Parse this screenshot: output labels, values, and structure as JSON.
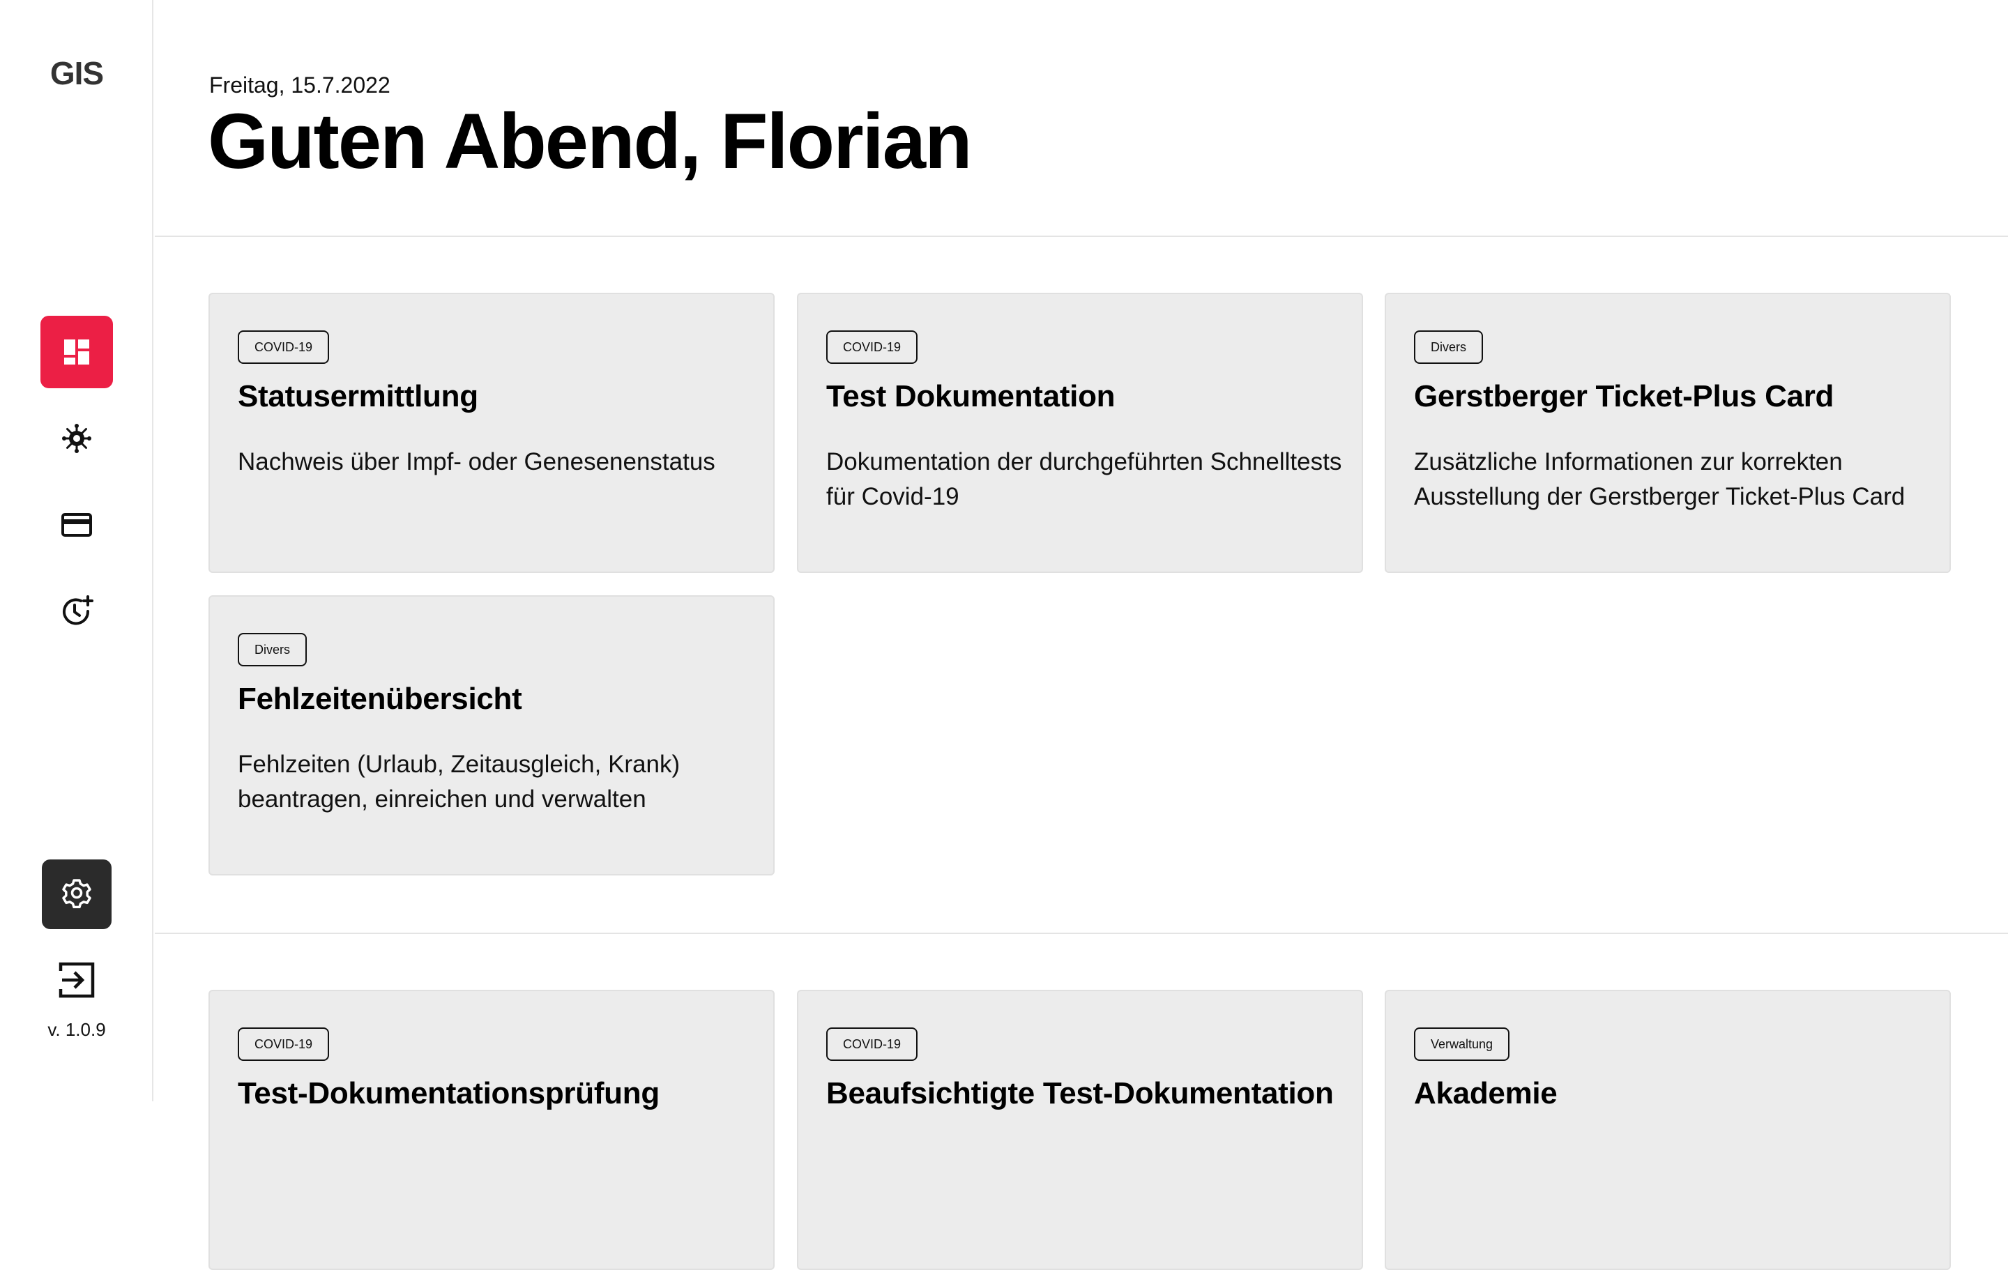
{
  "sidebar": {
    "logo": "GIS",
    "nav": [
      {
        "icon": "dashboard-icon",
        "active": true
      },
      {
        "icon": "virus-icon",
        "active": false
      },
      {
        "icon": "credit-card-icon",
        "active": false
      },
      {
        "icon": "clock-plus-icon",
        "active": false
      }
    ],
    "settings_icon": "gear-icon",
    "logout_icon": "logout-icon",
    "version": "v. 1.0.9"
  },
  "header": {
    "date": "Freitag, 15.7.2022",
    "greeting": "Guten Abend, Florian"
  },
  "colors": {
    "accent": "#ec1f45",
    "card_bg": "#ececec",
    "settings_bg": "#2b2b2b"
  },
  "cards": [
    {
      "tag": "COVID-19",
      "title": "Statusermittlung",
      "description": "Nachweis über Impf- oder Genesenenstatus"
    },
    {
      "tag": "COVID-19",
      "title": "Test Dokumentation",
      "description": "Dokumentation der durchgeführten Schnelltests für Covid-19"
    },
    {
      "tag": "Divers",
      "title": "Gerstberger Ticket-Plus Card",
      "description": "Zusätzliche Informationen zur korrekten Ausstellung der Gerstberger Ticket-Plus Card"
    },
    {
      "tag": "Divers",
      "title": "Fehlzeitenübersicht",
      "description": "Fehlzeiten (Urlaub, Zeitausgleich, Krank) beantragen, einreichen und verwalten"
    }
  ],
  "cards_section2": [
    {
      "tag": "COVID-19",
      "title": "Test-Dokumentationsprüfung"
    },
    {
      "tag": "COVID-19",
      "title": "Beaufsichtigte Test-Dokumentation"
    },
    {
      "tag": "Verwaltung",
      "title": "Akademie"
    }
  ]
}
